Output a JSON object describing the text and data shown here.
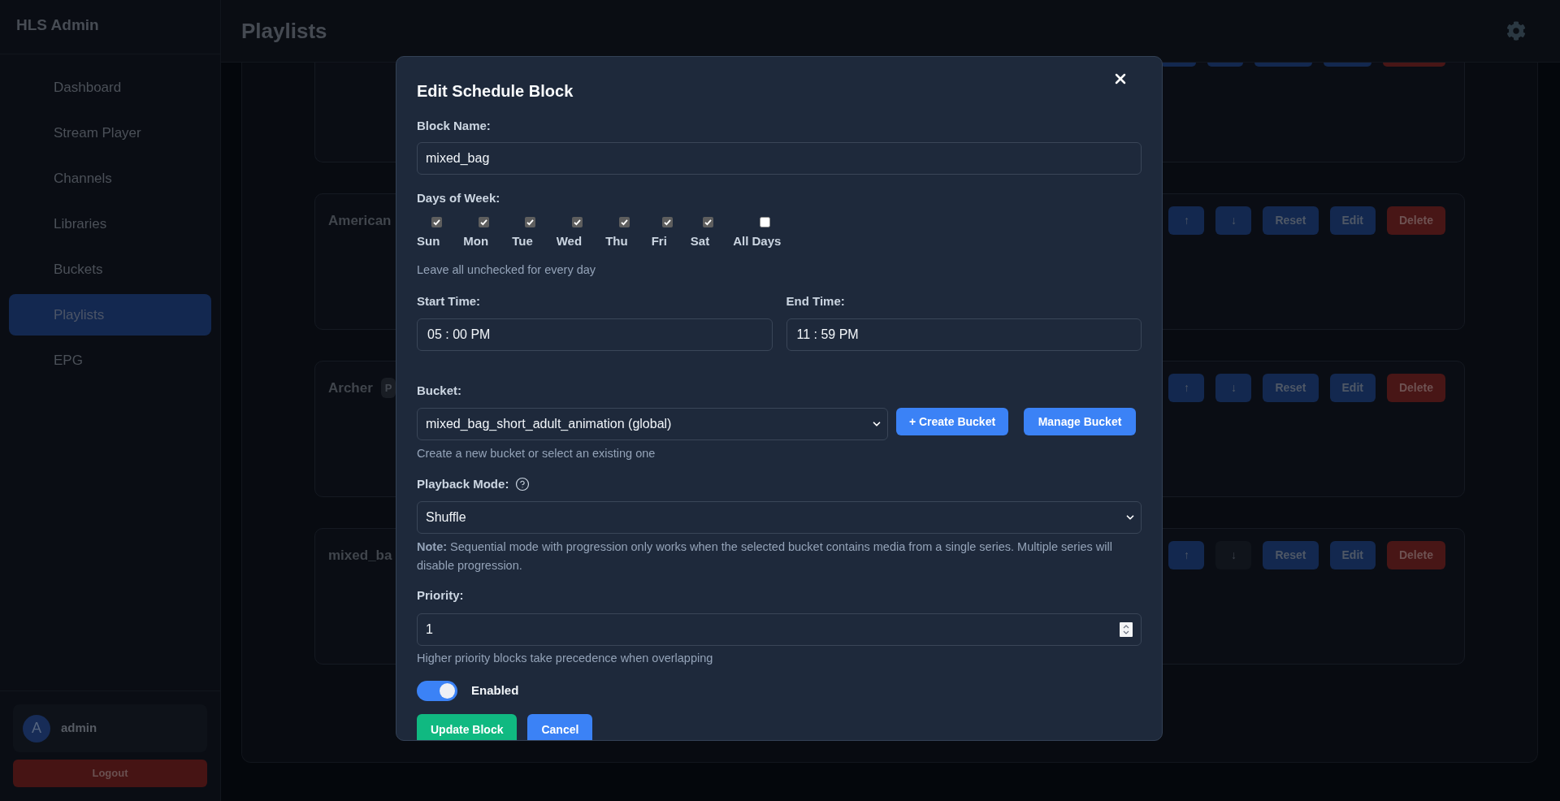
{
  "sidebar": {
    "title": "HLS Admin",
    "items": [
      {
        "label": "Dashboard",
        "selected": false
      },
      {
        "label": "Stream Player",
        "selected": false
      },
      {
        "label": "Channels",
        "selected": false
      },
      {
        "label": "Libraries",
        "selected": false
      },
      {
        "label": "Buckets",
        "selected": false
      },
      {
        "label": "Playlists",
        "selected": true
      },
      {
        "label": "EPG",
        "selected": false
      }
    ],
    "user": {
      "initial": "A",
      "name": "admin"
    },
    "logout": "Logout"
  },
  "header": {
    "title": "Playlists"
  },
  "playlists": [
    {
      "kind": "partial",
      "buttons": [
        {
          "kind": "primary",
          "disabled": false
        },
        {
          "kind": "primary",
          "disabled": false
        },
        {
          "kind": "primary",
          "disabled": false
        },
        {
          "kind": "primary",
          "disabled": false
        },
        {
          "kind": "danger",
          "disabled": false
        }
      ]
    },
    {
      "kind": "full",
      "title": "American",
      "buttons": [
        {
          "kind": "primary",
          "label": "↑",
          "disabled": false
        },
        {
          "kind": "primary",
          "label": "↓",
          "disabled": false
        },
        {
          "kind": "primary",
          "label": "Reset",
          "disabled": false
        },
        {
          "kind": "primary",
          "label": "Edit",
          "disabled": false
        },
        {
          "kind": "danger",
          "label": "Delete",
          "disabled": false
        }
      ]
    },
    {
      "kind": "full",
      "title": "Archer",
      "badge": "P",
      "buttons": [
        {
          "kind": "primary",
          "label": "↑",
          "disabled": false
        },
        {
          "kind": "primary",
          "label": "↓",
          "disabled": false
        },
        {
          "kind": "primary",
          "label": "Reset",
          "disabled": false
        },
        {
          "kind": "primary",
          "label": "Edit",
          "disabled": false
        },
        {
          "kind": "danger",
          "label": "Delete",
          "disabled": false
        }
      ]
    },
    {
      "kind": "full",
      "title": "mixed_ba",
      "buttons": [
        {
          "kind": "primary",
          "label": "↑",
          "disabled": false
        },
        {
          "kind": "primary",
          "label": "↓",
          "disabled": true
        },
        {
          "kind": "primary",
          "label": "Reset",
          "disabled": false
        },
        {
          "kind": "primary",
          "label": "Edit",
          "disabled": false
        },
        {
          "kind": "danger",
          "label": "Delete",
          "disabled": false
        }
      ]
    }
  ],
  "modal": {
    "title": "Edit Schedule Block",
    "block_name": {
      "label": "Block Name:",
      "value": "mixed_bag"
    },
    "days": {
      "label": "Days of Week:",
      "items": [
        {
          "label": "Sun",
          "checked": true
        },
        {
          "label": "Mon",
          "checked": true
        },
        {
          "label": "Tue",
          "checked": true
        },
        {
          "label": "Wed",
          "checked": true
        },
        {
          "label": "Thu",
          "checked": true
        },
        {
          "label": "Fri",
          "checked": true
        },
        {
          "label": "Sat",
          "checked": true
        },
        {
          "label": "All Days",
          "checked": false
        }
      ],
      "hint": "Leave all unchecked for every day"
    },
    "start_time": {
      "label": "Start Time:",
      "value": "05 : 00 PM"
    },
    "end_time": {
      "label": "End Time:",
      "value": "11 : 59 PM"
    },
    "bucket": {
      "label": "Bucket:",
      "value": "mixed_bag_short_adult_animation (global)",
      "buttons": [
        "+ Create Bucket",
        "Manage Bucket"
      ],
      "hint": "Create a new bucket or select an existing one"
    },
    "playback_mode": {
      "label": "Playback Mode:",
      "value": "Shuffle",
      "note": "**Note:** Sequential mode with progression only works when the selected bucket contains media from a single series. Multiple series will disable progression."
    },
    "priority": {
      "label": "Priority:",
      "value": "1",
      "hint": "Higher priority blocks take precedence when overlapping"
    },
    "enabled": {
      "label": "Enabled",
      "on": true
    },
    "actions": [
      {
        "kind": "success",
        "label": "Update Block"
      },
      {
        "kind": "primary",
        "label": "Cancel"
      }
    ]
  }
}
